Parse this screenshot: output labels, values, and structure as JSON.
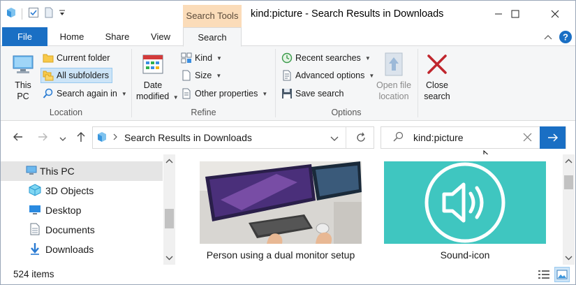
{
  "window": {
    "title": "kind:picture - Search Results in Downloads",
    "context_tab": "Search Tools"
  },
  "tabs": {
    "file": "File",
    "home": "Home",
    "share": "Share",
    "view": "View",
    "search": "Search"
  },
  "ribbon": {
    "location": {
      "label": "Location",
      "this_pc_line1": "This",
      "this_pc_line2": "PC",
      "current_folder": "Current folder",
      "all_subfolders": "All subfolders",
      "search_again": "Search again in"
    },
    "refine": {
      "label": "Refine",
      "date_modified_line1": "Date",
      "date_modified_line2": "modified",
      "kind": "Kind",
      "size": "Size",
      "other_properties": "Other properties"
    },
    "options": {
      "label": "Options",
      "recent_searches": "Recent searches",
      "advanced_options": "Advanced options",
      "save_search": "Save search",
      "open_file_location_line1": "Open file",
      "open_file_location_line2": "location",
      "close_search_line1": "Close",
      "close_search_line2": "search"
    }
  },
  "address": {
    "path": "Search Results in Downloads"
  },
  "search": {
    "value": "kind:picture"
  },
  "nav": {
    "items": [
      {
        "label": "This PC"
      },
      {
        "label": "3D Objects"
      },
      {
        "label": "Desktop"
      },
      {
        "label": "Documents"
      },
      {
        "label": "Downloads"
      }
    ]
  },
  "files": [
    {
      "caption": "Person using a dual monitor setup"
    },
    {
      "caption": "Sound-icon"
    }
  ],
  "status": {
    "count": "524 items"
  },
  "colors": {
    "accent": "#1a6fc4",
    "context_tab": "#fbdcb9",
    "selection": "#cce4f7",
    "sound_tile": "#3fc6c0"
  }
}
